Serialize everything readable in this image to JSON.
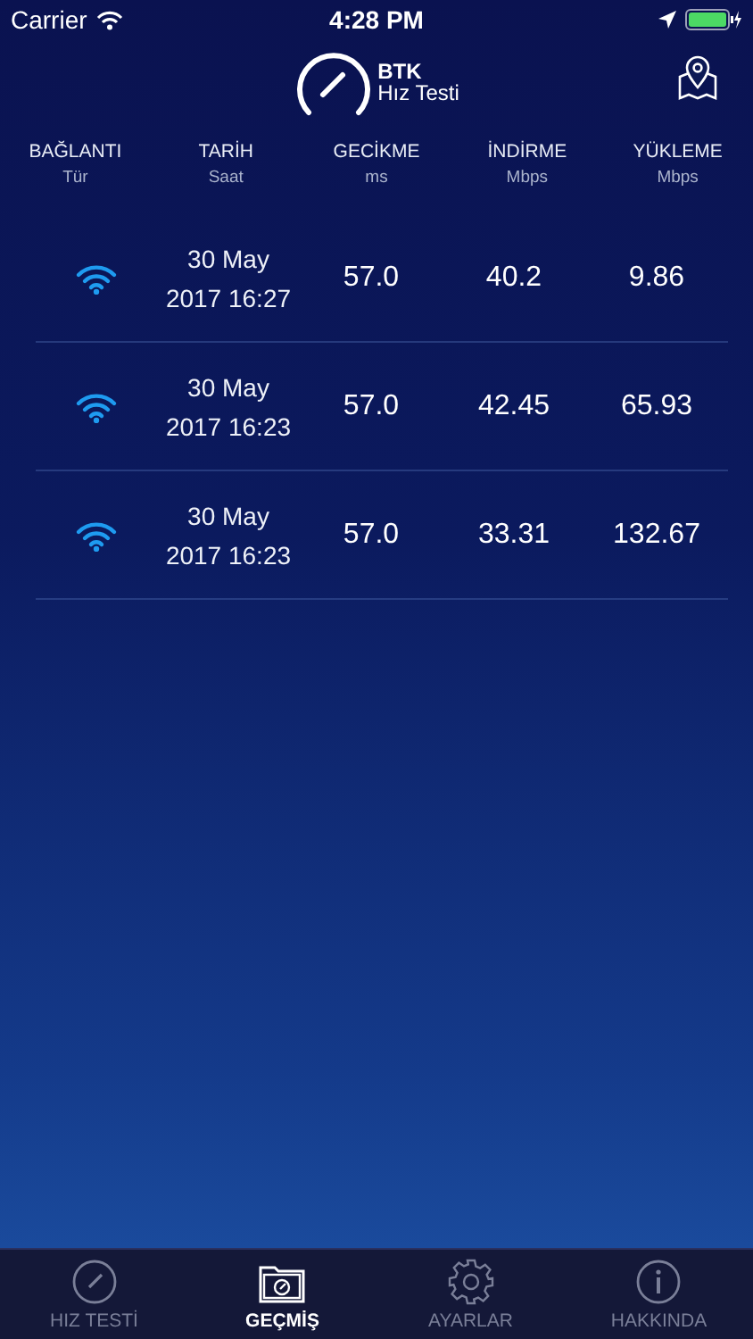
{
  "status_bar": {
    "carrier": "Carrier",
    "time": "4:28 PM"
  },
  "header": {
    "brand": "BTK",
    "subtitle": "Hız Testi"
  },
  "table": {
    "columns": [
      {
        "title": "BAĞLANTI",
        "unit": "Tür"
      },
      {
        "title": "TARİH",
        "unit": "Saat"
      },
      {
        "title": "GECİKME",
        "unit": "ms"
      },
      {
        "title": "İNDİRME",
        "unit": "Mbps"
      },
      {
        "title": "YÜKLEME",
        "unit": "Mbps"
      }
    ],
    "rows": [
      {
        "kind": "wifi",
        "date": "30 May",
        "time": "2017 16:27",
        "latency": "57.0",
        "download": "40.2",
        "upload": "9.86"
      },
      {
        "kind": "wifi",
        "date": "30 May",
        "time": "2017 16:23",
        "latency": "57.0",
        "download": "42.45",
        "upload": "65.93"
      },
      {
        "kind": "wifi",
        "date": "30 May",
        "time": "2017 16:23",
        "latency": "57.0",
        "download": "33.31",
        "upload": "132.67"
      }
    ]
  },
  "tab_bar": [
    {
      "label": "HIZ TESTİ",
      "kind": "speedometer",
      "selected": false
    },
    {
      "label": "GEÇMİŞ",
      "kind": "folder",
      "selected": true
    },
    {
      "label": "AYARLAR",
      "kind": "gear",
      "selected": false
    },
    {
      "label": "HAKKINDA",
      "kind": "info",
      "selected": false
    }
  ]
}
